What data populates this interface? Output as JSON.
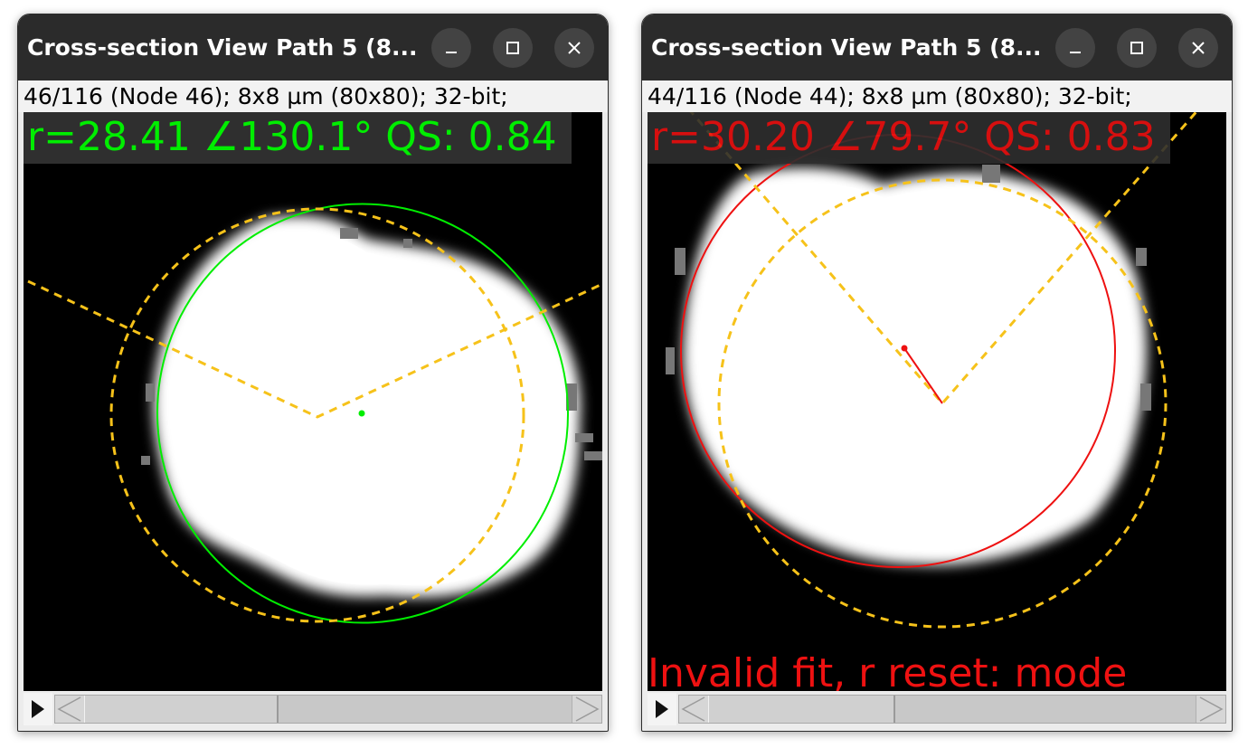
{
  "colors": {
    "fit_ok": "#00ee00",
    "fit_bad": "#ee1111",
    "guide": "#f6c21a",
    "background": "#000000"
  },
  "windows": [
    {
      "title": "Cross-section View Path 5 (8...",
      "info": "46/116 (Node 46); 8x8 µm (80x80); 32-bit;",
      "overlay": "r=28.41 ∠130.1° QS: 0.84",
      "status": "ok",
      "play_icon": "play-icon"
    },
    {
      "title": "Cross-section View Path 5 (8...",
      "info": "44/116 (Node 44); 8x8 µm (80x80); 32-bit;",
      "overlay": "r=30.20 ∠79.7° QS: 0.83",
      "warning": "Invalid fit, r reset: mode",
      "status": "invalid",
      "play_icon": "play-icon"
    }
  ]
}
